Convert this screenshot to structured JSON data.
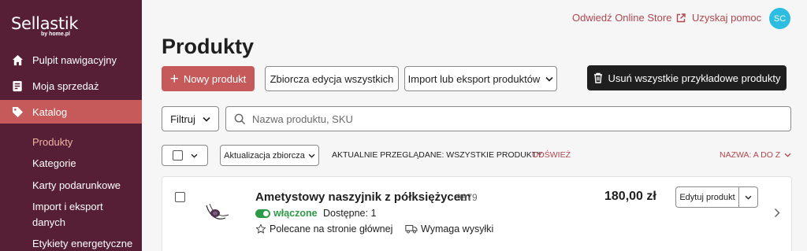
{
  "app": {
    "logo_text": "Sellastik",
    "logo_sub": "by home.pl"
  },
  "sidebar": {
    "items": [
      {
        "label": "Pulpit nawigacyjny",
        "icon": "home-icon"
      },
      {
        "label": "Moja sprzedaż",
        "icon": "receipt-icon"
      },
      {
        "label": "Katalog",
        "icon": "tag-icon"
      }
    ],
    "sub_items": [
      {
        "label": "Produkty"
      },
      {
        "label": "Kategorie"
      },
      {
        "label": "Karty podarunkowe"
      },
      {
        "label": "Import i eksport danych"
      },
      {
        "label": "Etykiety energetyczne"
      }
    ]
  },
  "topbar": {
    "visit_store": "Odwiedź Online Store",
    "help": "Uzyskaj pomoc",
    "avatar_initials": "SC"
  },
  "page": {
    "title": "Produkty"
  },
  "toolbar": {
    "new_product": "Nowy produkt",
    "bulk_edit_all": "Zbiorcza edycja wszystkich",
    "import_export": "Import lub eksport produktów",
    "delete_samples": "Usuń wszystkie przykładowe produkty"
  },
  "filters": {
    "filter_label": "Filtruj",
    "search_placeholder": "Nazwa produktu, SKU"
  },
  "list_header": {
    "bulk_update": "Aktualizacja zbiorcza",
    "currently_viewing": "AKTUALNIE PRZEGLĄDANE: WSZYSTKIE PRODUKTY",
    "refresh": "ODŚWIEŻ",
    "sort": "NAZWA: A DO Z"
  },
  "products": [
    {
      "name": "Ametystowy naszyjnik z półksiężycem",
      "sku": "9879",
      "status": "włączone",
      "stock": "Dostępne: 1",
      "featured": "Polecane na stronie głównej",
      "shipping": "Wymaga wysyłki",
      "price": "180,00 zł",
      "edit_label": "Edytuj produkt"
    }
  ],
  "colors": {
    "sidebar_bg": "#561f35",
    "accent": "#c65a5a",
    "link": "#b0474e",
    "enabled_green": "#2d9a47"
  }
}
